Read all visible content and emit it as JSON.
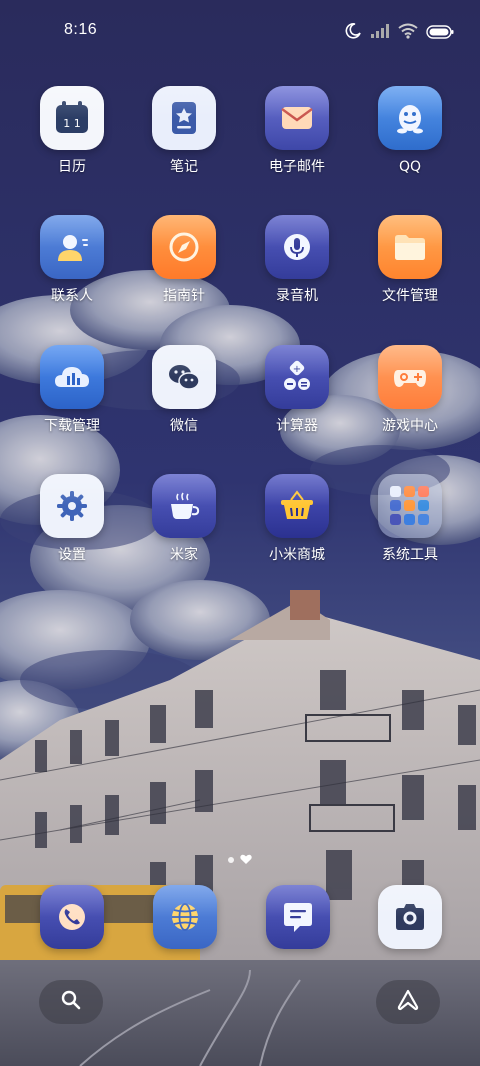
{
  "status_bar": {
    "time": "8:16",
    "icons": [
      "moon-icon",
      "signal-icon",
      "wifi-icon",
      "battery-icon"
    ]
  },
  "home_grid": [
    {
      "label": "日历",
      "icon": "calendar-icon",
      "color": "#ffffff",
      "calendar_text": "1 1"
    },
    {
      "label": "笔记",
      "icon": "notes-icon",
      "color": "#e8eefc"
    },
    {
      "label": "电子邮件",
      "icon": "mail-icon",
      "color": "#5a62c8"
    },
    {
      "label": "QQ",
      "icon": "qq-penguin-icon",
      "color": "#4a86e0"
    },
    {
      "label": "联系人",
      "icon": "contacts-icon",
      "color": "#4c7ed8"
    },
    {
      "label": "指南针",
      "icon": "compass-icon",
      "color": "#ff8a3d"
    },
    {
      "label": "录音机",
      "icon": "microphone-icon",
      "color": "#4a55b8"
    },
    {
      "label": "文件管理",
      "icon": "folder-icon",
      "color": "#ff9a3d"
    },
    {
      "label": "下载管理",
      "icon": "download-cloud-icon",
      "color": "#3d7fe0"
    },
    {
      "label": "微信",
      "icon": "wechat-icon",
      "color": "#eef2fb"
    },
    {
      "label": "计算器",
      "icon": "calculator-icon",
      "color": "#4a55b8"
    },
    {
      "label": "游戏中心",
      "icon": "gamepad-icon",
      "color": "#ff8a4a"
    },
    {
      "label": "设置",
      "icon": "gear-icon",
      "color": "#eef2fb"
    },
    {
      "label": "米家",
      "icon": "coffee-cup-icon",
      "color": "#4a55b8"
    },
    {
      "label": "小米商城",
      "icon": "shopping-basket-icon",
      "color": "#3b3f9e"
    },
    {
      "label": "系统工具",
      "icon": "folder-grid-icon",
      "color": "#8f9ec0"
    }
  ],
  "dock": [
    {
      "icon": "phone-icon",
      "color": "#4a55b8"
    },
    {
      "icon": "browser-globe-icon",
      "color": "#4c7ed8"
    },
    {
      "icon": "messages-icon",
      "color": "#4a55b8"
    },
    {
      "icon": "camera-icon",
      "color": "#eef2fb"
    }
  ],
  "bottom_buttons": [
    {
      "icon": "search-icon"
    },
    {
      "icon": "app-drawer-icon"
    }
  ],
  "page_indicator": {
    "pages": 2,
    "current": 2
  }
}
